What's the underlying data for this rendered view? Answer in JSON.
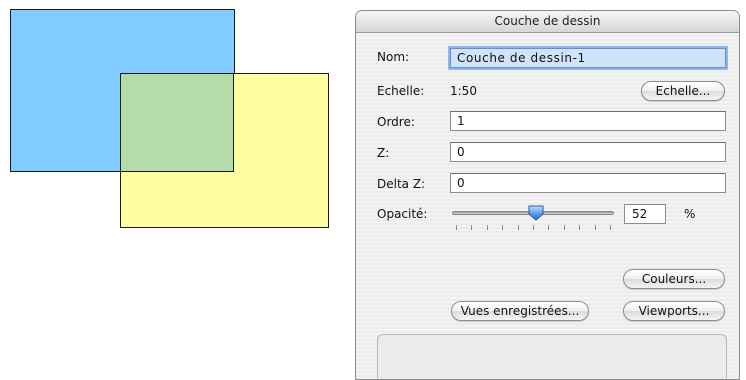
{
  "palette": {
    "title": "Couche de dessin",
    "nom_label": "Nom:",
    "nom_value": "Couche de dessin-1",
    "echelle_label": "Echelle:",
    "echelle_value": "1:50",
    "echelle_button": "Echelle...",
    "ordre_label": "Ordre:",
    "ordre_value": "1",
    "z_label": "Z:",
    "z_value": "0",
    "delta_z_label": "Delta Z:",
    "delta_z_value": "0",
    "opacite_label": "Opacité:",
    "opacite_value": "52",
    "opacite_unit": "%",
    "couleurs_button": "Couleurs...",
    "vues_button": "Vues enregistrées...",
    "viewports_button": "Viewports..."
  },
  "drawing": {
    "blue_fill": "#80cbff",
    "yellow_fill": "#ffffa2",
    "overlap_fill": "#b4dba8"
  },
  "slider": {
    "opacity_fraction": 0.52
  }
}
